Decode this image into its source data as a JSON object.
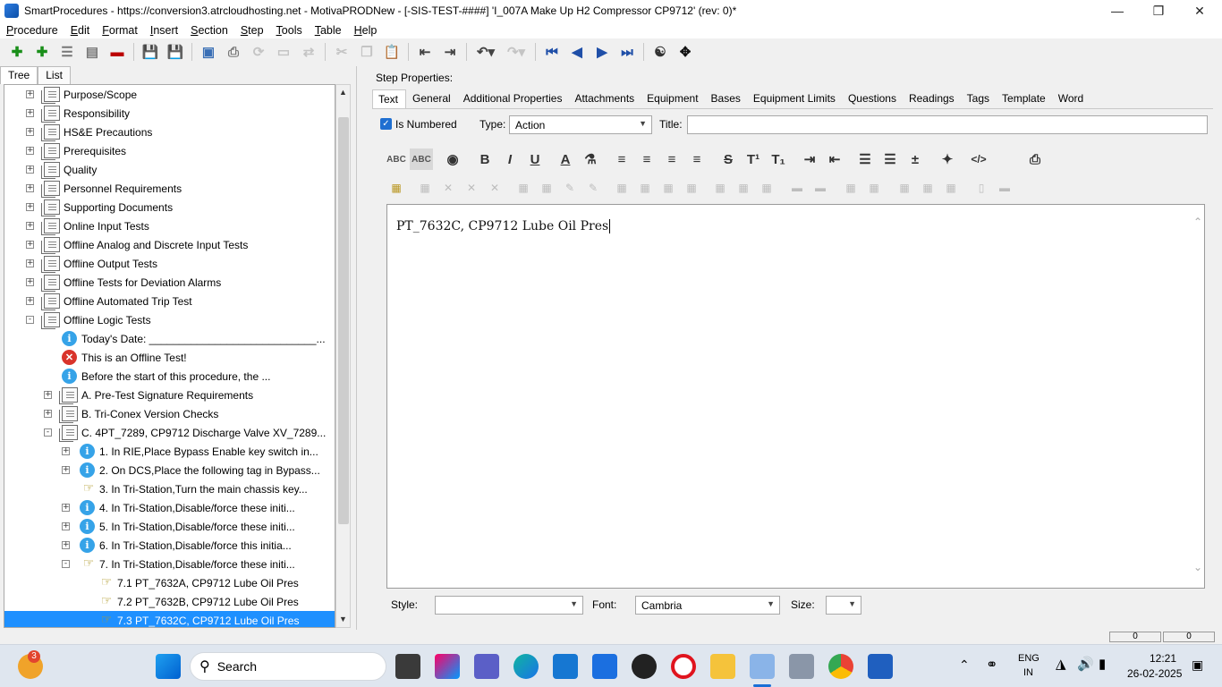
{
  "window": {
    "title": "SmartProcedures - https://conversion3.atrcloudhosting.net - MotivaPRODNew - [-SIS-TEST-####] 'I_007A Make Up H2 Compressor CP9712' (rev: 0)*"
  },
  "menu": [
    "Procedure",
    "Edit",
    "Format",
    "Insert",
    "Section",
    "Step",
    "Tools",
    "Table",
    "Help"
  ],
  "left_tabs": [
    "Tree",
    "List"
  ],
  "tree": [
    {
      "label": "Purpose/Scope",
      "icon": "document-icon",
      "expander": "+",
      "level": 0
    },
    {
      "label": "Responsibility",
      "icon": "document-icon",
      "expander": "+",
      "level": 0
    },
    {
      "label": "HS&E Precautions",
      "icon": "document-icon",
      "expander": "+",
      "level": 0
    },
    {
      "label": "Prerequisites",
      "icon": "document-icon",
      "expander": "+",
      "level": 0
    },
    {
      "label": "Quality",
      "icon": "document-icon",
      "expander": "+",
      "level": 0
    },
    {
      "label": "Personnel Requirements",
      "icon": "document-icon",
      "expander": "+",
      "level": 0
    },
    {
      "label": "Supporting Documents",
      "icon": "document-icon",
      "expander": "+",
      "level": 0
    },
    {
      "label": "Online Input Tests",
      "icon": "document-icon",
      "expander": "+",
      "level": 0
    },
    {
      "label": "Offline Analog and Discrete Input Tests",
      "icon": "document-icon",
      "expander": "+",
      "level": 0
    },
    {
      "label": "Offline Output Tests",
      "icon": "document-icon",
      "expander": "+",
      "level": 0
    },
    {
      "label": "Offline Tests for Deviation Alarms",
      "icon": "document-icon",
      "expander": "+",
      "level": 0
    },
    {
      "label": "Offline Automated Trip Test",
      "icon": "document-icon",
      "expander": "+",
      "level": 0
    },
    {
      "label": "Offline Logic Tests",
      "icon": "document-icon",
      "expander": "-",
      "level": 0
    },
    {
      "label": "Today's Date: ____________________________...",
      "icon": "info-icon",
      "expander": "",
      "level": 1
    },
    {
      "label": "This is an Offline Test!",
      "icon": "error-icon",
      "expander": "",
      "level": 1
    },
    {
      "label": "Before the start of this procedure, the ...",
      "icon": "info-icon",
      "expander": "",
      "level": 1
    },
    {
      "label": "A. Pre-Test Signature Requirements",
      "icon": "document-icon",
      "expander": "+",
      "level": 1
    },
    {
      "label": "B. Tri-Conex Version Checks",
      "icon": "document-icon",
      "expander": "+",
      "level": 1
    },
    {
      "label": "C. 4PT_7289, CP9712 Discharge Valve XV_7289...",
      "icon": "document-icon",
      "expander": "-",
      "level": 1
    },
    {
      "label": "1. In RIE,Place Bypass Enable key switch in...",
      "icon": "info-icon",
      "expander": "+",
      "level": 2
    },
    {
      "label": "2. On DCS,Place the following tag in Bypass...",
      "icon": "info-icon",
      "expander": "+",
      "level": 2
    },
    {
      "label": "3. In Tri-Station,Turn the main chassis key...",
      "icon": "action-hand-icon",
      "expander": "",
      "level": 2
    },
    {
      "label": "4. In Tri-Station,Disable/force these initi...",
      "icon": "info-icon",
      "expander": "+",
      "level": 2
    },
    {
      "label": "5. In Tri-Station,Disable/force these initi...",
      "icon": "info-icon",
      "expander": "+",
      "level": 2
    },
    {
      "label": "6. In Tri-Station,Disable/force this initia...",
      "icon": "info-icon",
      "expander": "+",
      "level": 2
    },
    {
      "label": "7. In Tri-Station,Disable/force these initi...",
      "icon": "action-hand-icon",
      "expander": "-",
      "level": 2
    },
    {
      "label": "7.1 PT_7632A, CP9712 Lube Oil Pres",
      "icon": "action-hand-icon",
      "expander": "",
      "level": 3
    },
    {
      "label": "7.2 PT_7632B, CP9712 Lube Oil Pres",
      "icon": "action-hand-icon",
      "expander": "",
      "level": 3
    },
    {
      "label": "7.3 PT_7632C, CP9712 Lube Oil Pres",
      "icon": "action-hand-icon",
      "expander": "",
      "level": 3,
      "selected": true
    }
  ],
  "step_properties": {
    "heading": "Step Properties:",
    "tabs": [
      "Text",
      "General",
      "Additional Properties",
      "Attachments",
      "Equipment",
      "Bases",
      "Equipment Limits",
      "Questions",
      "Readings",
      "Tags",
      "Template",
      "Word"
    ],
    "active_tab": "Text",
    "is_numbered_label": "Is Numbered",
    "is_numbered": true,
    "type_label": "Type:",
    "type_value": "Action",
    "title_label": "Title:",
    "title_value": "",
    "editor_text": "PT_7632C, CP9712 Lube Oil Pres",
    "style_label": "Style:",
    "style_value": "",
    "font_label": "Font:",
    "font_value": "Cambria",
    "size_label": "Size:",
    "size_value": ""
  },
  "status": {
    "left": "0",
    "right": "0"
  },
  "taskbar": {
    "search_placeholder": "Search",
    "notification_badge": "3",
    "lang_line1": "ENG",
    "lang_line2": "IN",
    "time": "12:21",
    "date": "26-02-2025"
  }
}
